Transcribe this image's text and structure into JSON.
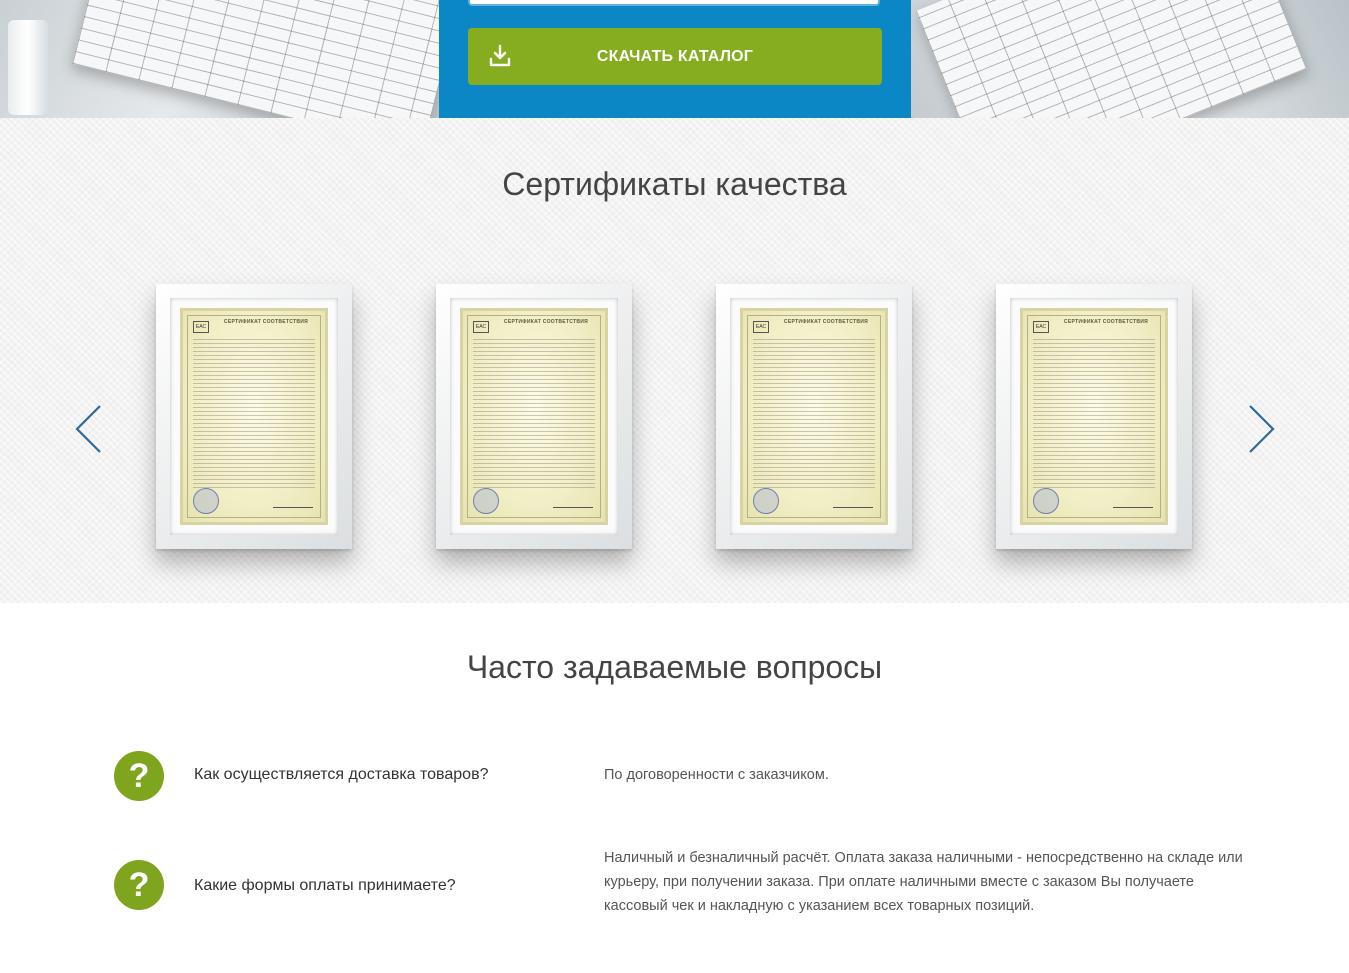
{
  "hero": {
    "download_button": {
      "label": "СКАЧАТЬ КАТАЛОГ",
      "icon": "download-icon"
    },
    "colors": {
      "panel": "#0b87c6",
      "button": "#86ac1f"
    }
  },
  "certificates": {
    "title": "Сертификаты качества",
    "prev_icon": "chevron-left-icon",
    "next_icon": "chevron-right-icon",
    "items": [
      {
        "header": "СЕРТИФИКАТ СООТВЕТСТВИЯ",
        "mark": "EAC"
      },
      {
        "header": "СЕРТИФИКАТ СООТВЕТСТВИЯ",
        "mark": "EAC"
      },
      {
        "header": "СЕРТИФИКАТ СООТВЕТСТВИЯ",
        "mark": "EAC"
      },
      {
        "header": "СЕРТИФИКАТ СООТВЕТСТВИЯ",
        "mark": "EAC"
      }
    ]
  },
  "faq": {
    "title": "Часто задаваемые вопросы",
    "icon": "question-mark-icon",
    "icon_glyph": "?",
    "accent_color": "#7fa51e",
    "items": [
      {
        "question": "Как осуществляется доставка товаров?",
        "answer": "По договоренности с заказчиком."
      },
      {
        "question": "Какие формы оплаты принимаете?",
        "answer": "Наличный и безналичный расчёт. Оплата заказа наличными - непосредственно на складе или курьеру, при получении заказа. При оплате наличными вместе с заказом Вы получаете кассовый чек и накладную с указанием всех товарных позиций."
      }
    ]
  }
}
